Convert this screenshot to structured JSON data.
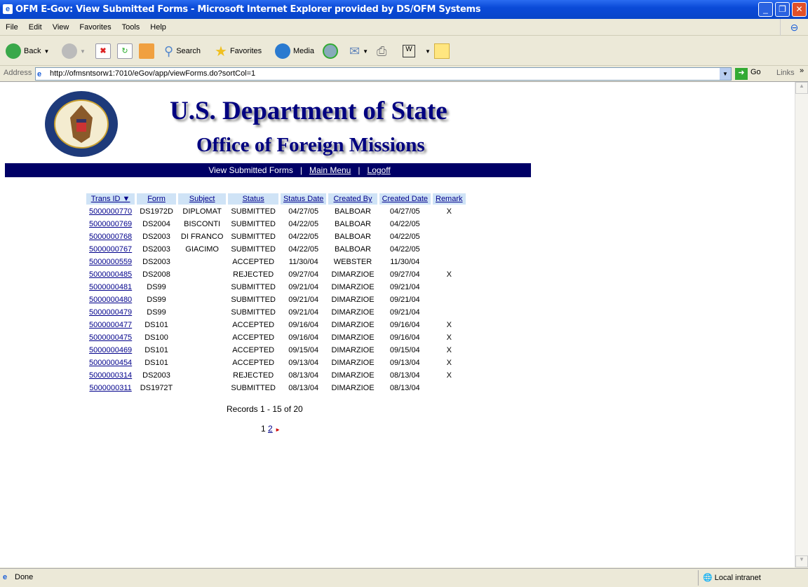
{
  "window": {
    "title": "OFM E-Gov: View Submitted Forms - Microsoft Internet Explorer provided by DS/OFM Systems"
  },
  "menu": [
    "File",
    "Edit",
    "View",
    "Favorites",
    "Tools",
    "Help"
  ],
  "toolbar": {
    "back": "Back",
    "search": "Search",
    "favorites": "Favorites",
    "media": "Media"
  },
  "address": {
    "label": "Address",
    "url": "http://ofmsntsorw1:7010/eGov/app/viewForms.do?sortCol=1",
    "go": "Go",
    "links": "Links"
  },
  "banner": {
    "title": "U.S. Department of State",
    "subtitle": "Office of Foreign Missions",
    "seal_text": "DEPARTMENT OF STATE · UNITED STATES OF AMERICA"
  },
  "nav": {
    "current": "View Submitted Forms",
    "main_menu": "Main Menu",
    "logoff": "Logoff",
    "sep": "|"
  },
  "table": {
    "headers": [
      "Trans ID ▼",
      "Form",
      "Subject",
      "Status",
      "Status Date",
      "Created By",
      "Created Date",
      "Remark"
    ],
    "rows": [
      [
        "5000000770",
        "DS1972D",
        "DIPLOMAT",
        "SUBMITTED",
        "04/27/05",
        "BALBOAR",
        "04/27/05",
        "X"
      ],
      [
        "5000000769",
        "DS2004",
        "BISCONTI",
        "SUBMITTED",
        "04/22/05",
        "BALBOAR",
        "04/22/05",
        ""
      ],
      [
        "5000000768",
        "DS2003",
        "DI FRANCO",
        "SUBMITTED",
        "04/22/05",
        "BALBOAR",
        "04/22/05",
        ""
      ],
      [
        "5000000767",
        "DS2003",
        "GIACIMO",
        "SUBMITTED",
        "04/22/05",
        "BALBOAR",
        "04/22/05",
        ""
      ],
      [
        "5000000559",
        "DS2003",
        "",
        "ACCEPTED",
        "11/30/04",
        "WEBSTER",
        "11/30/04",
        ""
      ],
      [
        "5000000485",
        "DS2008",
        "",
        "REJECTED",
        "09/27/04",
        "DIMARZIOE",
        "09/27/04",
        "X"
      ],
      [
        "5000000481",
        "DS99",
        "",
        "SUBMITTED",
        "09/21/04",
        "DIMARZIOE",
        "09/21/04",
        ""
      ],
      [
        "5000000480",
        "DS99",
        "",
        "SUBMITTED",
        "09/21/04",
        "DIMARZIOE",
        "09/21/04",
        ""
      ],
      [
        "5000000479",
        "DS99",
        "",
        "SUBMITTED",
        "09/21/04",
        "DIMARZIOE",
        "09/21/04",
        ""
      ],
      [
        "5000000477",
        "DS101",
        "",
        "ACCEPTED",
        "09/16/04",
        "DIMARZIOE",
        "09/16/04",
        "X"
      ],
      [
        "5000000475",
        "DS100",
        "",
        "ACCEPTED",
        "09/16/04",
        "DIMARZIOE",
        "09/16/04",
        "X"
      ],
      [
        "5000000469",
        "DS101",
        "",
        "ACCEPTED",
        "09/15/04",
        "DIMARZIOE",
        "09/15/04",
        "X"
      ],
      [
        "5000000454",
        "DS101",
        "",
        "ACCEPTED",
        "09/13/04",
        "DIMARZIOE",
        "09/13/04",
        "X"
      ],
      [
        "5000000314",
        "DS2003",
        "",
        "REJECTED",
        "08/13/04",
        "DIMARZIOE",
        "08/13/04",
        "X"
      ],
      [
        "5000000311",
        "DS1972T",
        "",
        "SUBMITTED",
        "08/13/04",
        "DIMARZIOE",
        "08/13/04",
        ""
      ]
    ]
  },
  "records": "Records 1 - 15 of 20",
  "pagination": {
    "current": "1",
    "next_page": "2"
  },
  "status": {
    "text": "Done",
    "zone": "Local intranet"
  }
}
